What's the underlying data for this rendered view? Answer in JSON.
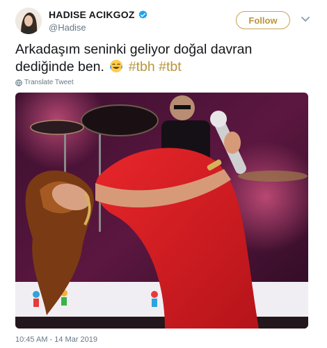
{
  "author": {
    "name": "HADISE ACIKGOZ",
    "handle": "@Hadise",
    "verified": true
  },
  "follow_label": "Follow",
  "tweet": {
    "text": "Arkadaşım seninki geliyor doğal davran dediğinde ben.",
    "emoji": "face-with-tears-of-joy",
    "hashtags": [
      "#tbh",
      "#tbt"
    ]
  },
  "translate_label": "Translate Tweet",
  "timestamp": "10:45 AM - 14 Mar 2019",
  "colors": {
    "accent": "#b8963c",
    "verified": "#1da1f2",
    "muted": "#657786",
    "text": "#14171a"
  },
  "media": {
    "description_icon": "concert-photo"
  }
}
